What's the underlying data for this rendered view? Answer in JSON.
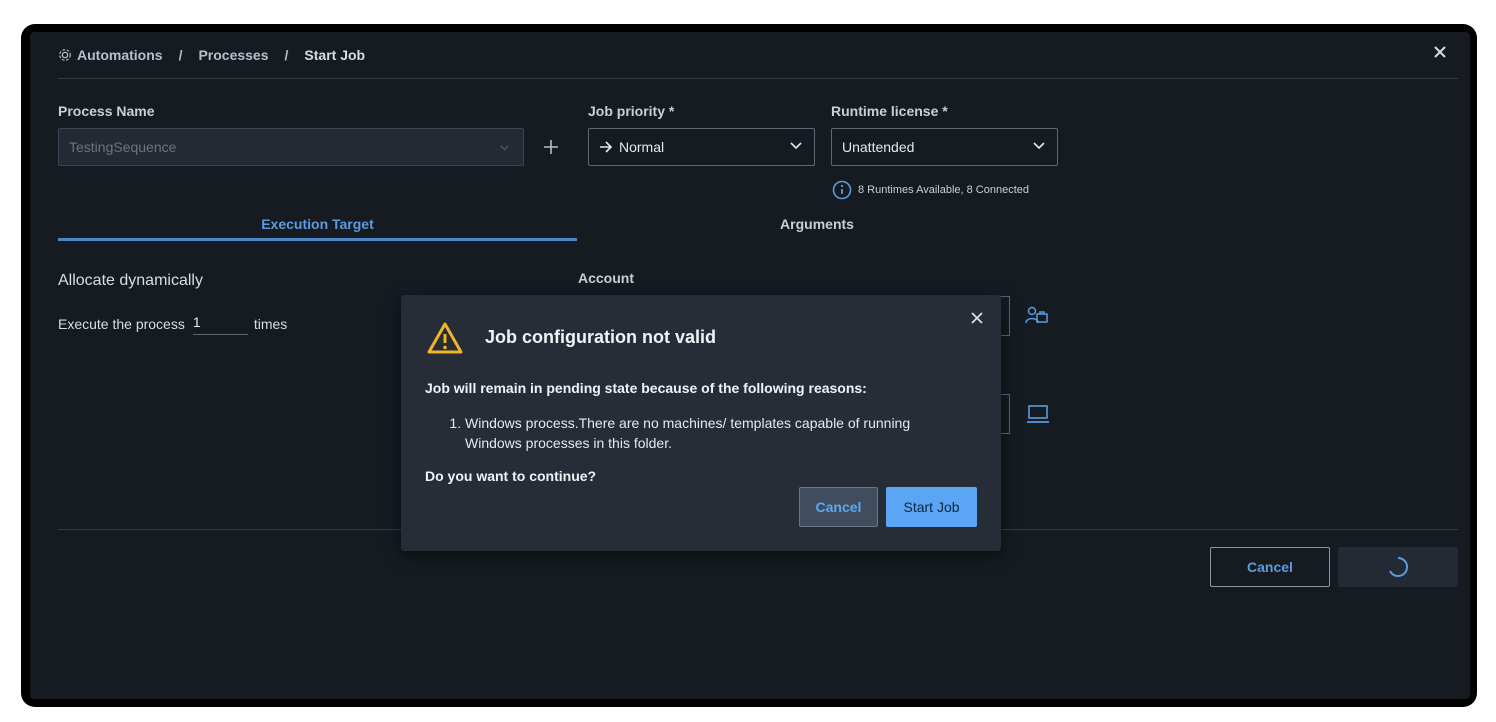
{
  "breadcrumb": {
    "items": [
      "Automations",
      "Processes",
      "Start Job"
    ],
    "separator": "/"
  },
  "form": {
    "process_name_label": "Process Name",
    "process_name_value": "TestingSequence",
    "job_priority_label": "Job priority *",
    "job_priority_value": "Normal",
    "runtime_license_label": "Runtime license *",
    "runtime_license_value": "Unattended",
    "runtimes_info": "8 Runtimes Available, 8 Connected"
  },
  "tabs": [
    {
      "label": "Execution Target",
      "active": true
    },
    {
      "label": "Arguments",
      "active": false
    }
  ],
  "execution": {
    "section_title": "Allocate dynamically",
    "execute_prefix": "Execute the process",
    "execute_count": "1",
    "execute_suffix": "times",
    "account_label": "Account"
  },
  "footer": {
    "cancel_label": "Cancel"
  },
  "modal": {
    "title": "Job configuration not valid",
    "reason_heading": "Job will remain in pending state because of the following reasons:",
    "reasons": [
      "Windows process.There are no machines/ templates capable of running Windows processes in this folder."
    ],
    "question": "Do you want to continue?",
    "cancel_label": "Cancel",
    "start_label": "Start Job"
  },
  "colors": {
    "accent": "#5b9bde",
    "warning": "#f0b429",
    "primary_button": "#5aa6f5",
    "background": "#161b22"
  },
  "icons": [
    "gear-icon",
    "close-icon",
    "chevron-down-icon",
    "plus-icon",
    "arrow-right-icon",
    "info-icon",
    "user-account-icon",
    "laptop-icon",
    "warning-icon",
    "spinner-icon"
  ]
}
